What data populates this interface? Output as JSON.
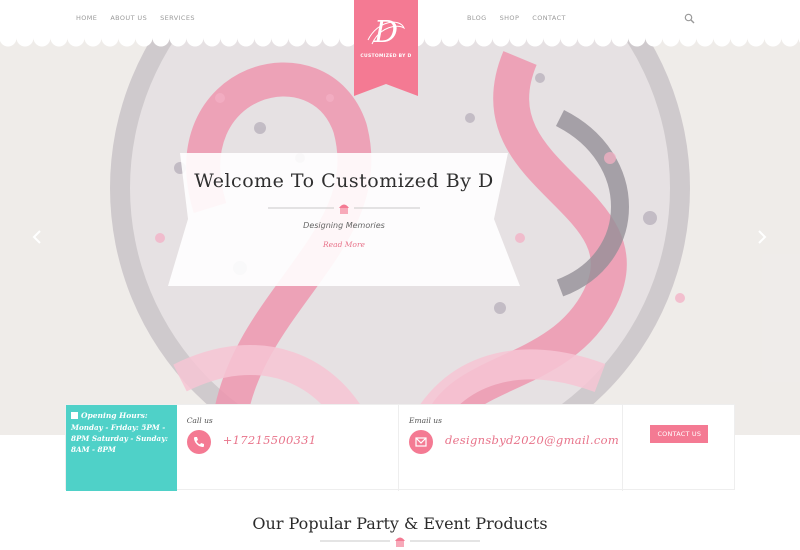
{
  "nav": {
    "left": [
      "HOME",
      "ABOUT US",
      "SERVICES"
    ],
    "right": [
      "BLOG",
      "SHOP",
      "CONTACT"
    ]
  },
  "logo": {
    "name": "CUSTOMIZED BY D",
    "letter": "D"
  },
  "hero": {
    "title": "Welcome To Customized By D",
    "tagline": "Designing Memories",
    "read_more": "Read More"
  },
  "info": {
    "hours_title": "Opening Hours:",
    "hours_text": "Monday - Friday: 5PM - 8PM Saturday - Sunday: 8AM - 8PM",
    "call_label": "Call us",
    "phone": "+17215500331",
    "email_label": "Email us",
    "email": "designsbyd2020@gmail.com",
    "contact_button": "CONTACT US"
  },
  "section": {
    "title": "Our Popular Party & Event Products"
  },
  "icons": {
    "search": "search-icon",
    "prev": "chevron-left-icon",
    "next": "chevron-right-icon",
    "phone": "phone-icon",
    "email": "envelope-icon",
    "cupcake": "cupcake-icon"
  },
  "colors": {
    "pink": "#f47a93",
    "teal": "#4fd1c8",
    "dark": "#2f2f2f"
  }
}
